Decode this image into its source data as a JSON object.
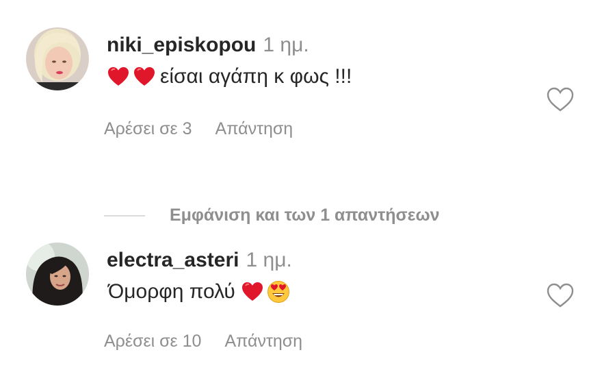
{
  "comments": [
    {
      "username": "niki_episkopou",
      "time": "1 ημ.",
      "text": "είσαι αγάπη κ φως !!!",
      "likes_label": "Αρέσει σε 3",
      "reply_label": "Απάντηση",
      "emojis_before": [
        "red-heart",
        "red-heart"
      ],
      "emojis_after": []
    },
    {
      "username": "electra_asteri",
      "time": "1 ημ.",
      "text": "Όμορφη πολύ",
      "likes_label": "Αρέσει σε 10",
      "reply_label": "Απάντηση",
      "emojis_before": [],
      "emojis_after": [
        "red-heart",
        "heart-eyes"
      ]
    }
  ],
  "view_replies_label": "Εμφάνιση και των 1 απαντήσεων",
  "colors": {
    "text": "#262626",
    "secondary": "#8e8e8e",
    "divider": "#dbdbdb",
    "heart": "#e0162b"
  }
}
